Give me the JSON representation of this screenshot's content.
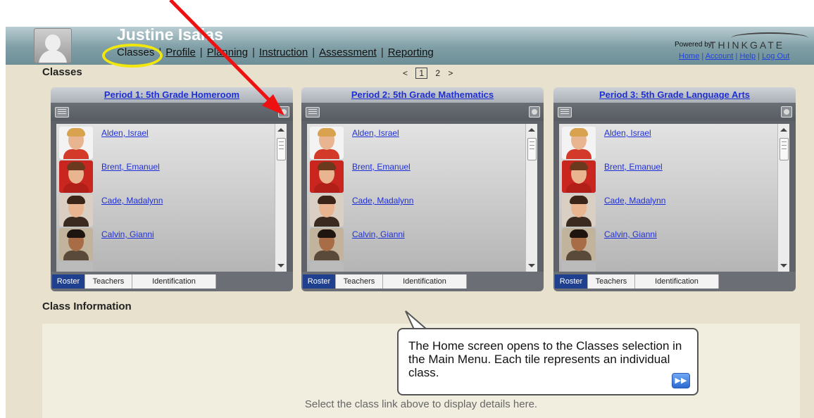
{
  "header": {
    "user_name": "Justine Isaias",
    "menu": [
      "Classes",
      "Profile",
      "Planning",
      "Instruction",
      "Assessment",
      "Reporting"
    ],
    "separator": "|",
    "powered_by": "Powered by:",
    "brand": "THINKGATE",
    "account_links": [
      "Home",
      "Account",
      "Help",
      "Log Out"
    ]
  },
  "classes": {
    "title": "Classes",
    "pager": {
      "prev": "<",
      "pages": [
        "1",
        "2"
      ],
      "next": ">"
    },
    "tiles": [
      {
        "title": "Period 1: 5th Grade Homeroom",
        "students": [
          "Alden, Israel",
          "Brent, Emanuel",
          "Cade, Madalynn",
          "Calvin, Gianni"
        ],
        "tabs": [
          "Roster",
          "Teachers",
          "Identification"
        ]
      },
      {
        "title": "Period 2: 5th Grade Mathematics",
        "students": [
          "Alden, Israel",
          "Brent, Emanuel",
          "Cade, Madalynn",
          "Calvin, Gianni"
        ],
        "tabs": [
          "Roster",
          "Teachers",
          "Identification"
        ]
      },
      {
        "title": "Period 3: 5th Grade Language Arts",
        "students": [
          "Alden, Israel",
          "Brent, Emanuel",
          "Cade, Madalynn",
          "Calvin, Gianni"
        ],
        "tabs": [
          "Roster",
          "Teachers",
          "Identification"
        ]
      }
    ]
  },
  "class_information": {
    "title": "Class Information",
    "placeholder": "Select the class link above to display details here."
  },
  "tooltip": {
    "text": "The Home screen opens to the Classes selection in the Main Menu.  Each tile represents an individual class.",
    "next_icon": "fast-forward-icon"
  },
  "colors": {
    "annotation_arrow": "#ee1111",
    "highlight_ellipse": "#f1e70d",
    "link": "#1f2fd6",
    "active_tab": "#1f3f8f"
  }
}
